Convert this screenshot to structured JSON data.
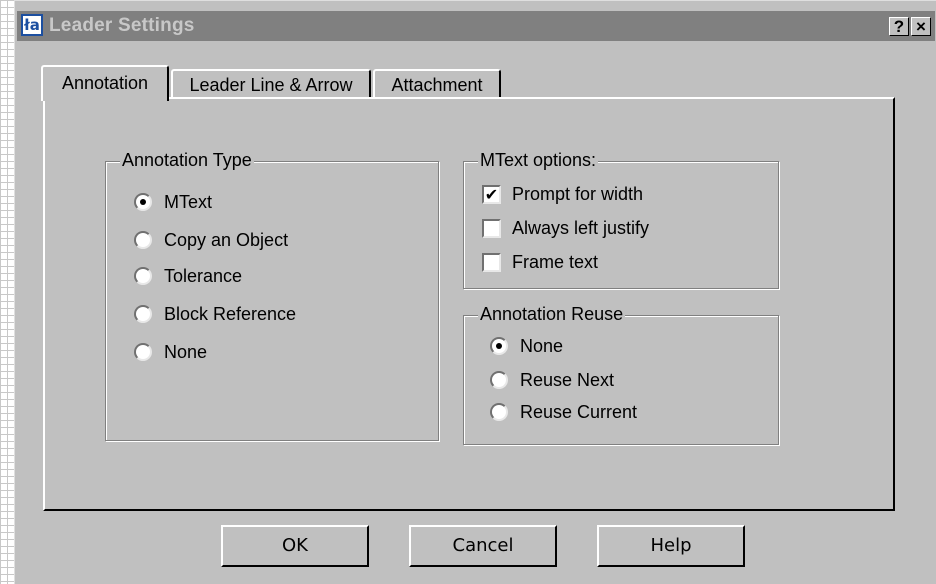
{
  "window": {
    "title": "Leader Settings",
    "app_icon_glyph": "ła",
    "help_button": "?",
    "close_button": "×"
  },
  "tabs": [
    {
      "label": "Annotation",
      "active": true
    },
    {
      "label": "Leader Line & Arrow",
      "active": false
    },
    {
      "label": "Attachment",
      "active": false
    }
  ],
  "annotation_type": {
    "legend": "Annotation Type",
    "options": [
      {
        "label": "MText",
        "selected": true
      },
      {
        "label": "Copy an Object",
        "selected": false
      },
      {
        "label": "Tolerance",
        "selected": false
      },
      {
        "label": "Block Reference",
        "selected": false
      },
      {
        "label": "None",
        "selected": false
      }
    ]
  },
  "mtext_options": {
    "legend": "MText options:",
    "options": [
      {
        "label": "Prompt for width",
        "checked": true,
        "mark": "✔"
      },
      {
        "label": "Always left justify",
        "checked": false,
        "mark": ""
      },
      {
        "label": "Frame text",
        "checked": false,
        "mark": ""
      }
    ]
  },
  "annotation_reuse": {
    "legend": "Annotation Reuse",
    "options": [
      {
        "label": "None",
        "selected": true
      },
      {
        "label": "Reuse Next",
        "selected": false
      },
      {
        "label": "Reuse Current",
        "selected": false
      }
    ]
  },
  "buttons": {
    "ok": "OK",
    "cancel": "Cancel",
    "help": "Help"
  },
  "colors": {
    "face": "#c0c0c0",
    "titlebar_inactive": "#808080",
    "icon_blue": "#1c4fa0"
  }
}
